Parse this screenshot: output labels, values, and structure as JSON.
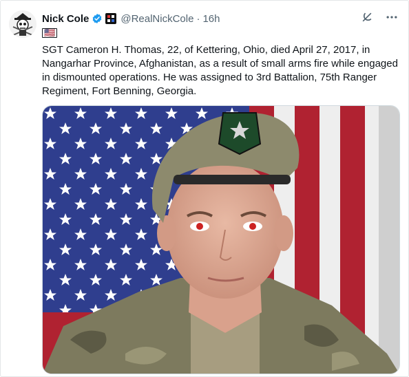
{
  "tweet": {
    "author_name": "Nick Cole",
    "handle": "@RealNickCole",
    "separator": "·",
    "time": "16h",
    "emoji_text": "🇺🇸",
    "text": "SGT Cameron H. Thomas, 22, of Kettering, Ohio, died April 27, 2017, in Nangarhar Province, Afghanistan, as a result of small arms fire while engaged in dismounted operations. He was assigned to 3rd Battalion, 75th Ranger Regiment, Fort Benning, Georgia."
  },
  "icons": {
    "verified": "verified-badge-icon",
    "affiliation": "affiliation-badge-icon",
    "grok": "grok-icon",
    "more": "more-icon"
  },
  "colors": {
    "verified_blue": "#1d9bf0",
    "text": "#0f1419",
    "secondary": "#536471"
  }
}
